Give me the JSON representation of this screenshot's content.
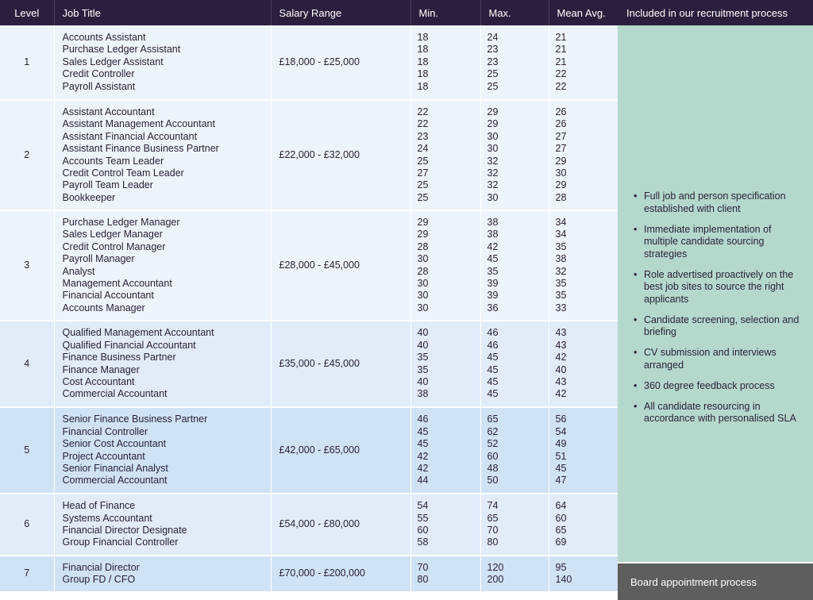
{
  "table": {
    "headers": [
      "Level",
      "Job Title",
      "Salary Range",
      "Min.",
      "Max.",
      "Mean Avg."
    ],
    "rows": [
      {
        "level": "1",
        "range": "£18,000 - £25,000",
        "titles": [
          "Accounts Assistant",
          "Purchase Ledger Assistant",
          "Sales Ledger Assistant",
          "Credit Controller",
          "Payroll Assistant"
        ],
        "min": [
          "18",
          "18",
          "18",
          "18",
          "18"
        ],
        "max": [
          "24",
          "23",
          "23",
          "25",
          "25"
        ],
        "mean": [
          "21",
          "21",
          "21",
          "22",
          "22"
        ]
      },
      {
        "level": "2",
        "range": "£22,000 - £32,000",
        "titles": [
          "Assistant Accountant",
          "Assistant Management Accountant",
          "Assistant Financial Accountant",
          "Assistant Finance Business Partner",
          "Accounts Team Leader",
          "Credit Control Team Leader",
          "Payroll Team Leader",
          "Bookkeeper"
        ],
        "min": [
          "22",
          "22",
          "23",
          "24",
          "25",
          "27",
          "25",
          "25"
        ],
        "max": [
          "29",
          "29",
          "30",
          "30",
          "32",
          "32",
          "32",
          "30"
        ],
        "mean": [
          "26",
          "26",
          "27",
          "27",
          "29",
          "30",
          "29",
          "28"
        ]
      },
      {
        "level": "3",
        "range": "£28,000 - £45,000",
        "titles": [
          "Purchase Ledger Manager",
          "Sales Ledger Manager",
          "Credit Control Manager",
          "Payroll Manager",
          "Analyst",
          "Management Accountant",
          "Financial Accountant",
          "Accounts Manager"
        ],
        "min": [
          "29",
          "29",
          "28",
          "30",
          "28",
          "30",
          "30",
          "30"
        ],
        "max": [
          "38",
          "38",
          "42",
          "45",
          "35",
          "39",
          "39",
          "36"
        ],
        "mean": [
          "34",
          "34",
          "35",
          "38",
          "32",
          "35",
          "35",
          "33"
        ]
      },
      {
        "level": "4",
        "range": "£35,000 - £45,000",
        "titles": [
          "Qualified Management Accountant",
          "Qualified Financial Accountant",
          "Finance Business Partner",
          "Finance Manager",
          "Cost Accountant",
          "Commercial Accountant"
        ],
        "min": [
          "40",
          "40",
          "35",
          "35",
          "40",
          "38"
        ],
        "max": [
          "46",
          "46",
          "45",
          "45",
          "45",
          "45"
        ],
        "mean": [
          "43",
          "43",
          "42",
          "40",
          "43",
          "42"
        ]
      },
      {
        "level": "5",
        "range": "£42,000 - £65,000",
        "titles": [
          "Senior Finance Business Partner",
          "Financial Controller",
          "Senior Cost Accountant",
          "Project Accountant",
          "Senior Financial Analyst",
          "Commercial Accountant"
        ],
        "min": [
          "46",
          "45",
          "45",
          "42",
          "42",
          "44"
        ],
        "max": [
          "65",
          "62",
          "52",
          "60",
          "48",
          "50"
        ],
        "mean": [
          "56",
          "54",
          "49",
          "51",
          "45",
          "47"
        ]
      },
      {
        "level": "6",
        "range": "£54,000 - £80,000",
        "titles": [
          "Head of Finance",
          "Systems Accountant",
          "Financial Director Designate",
          "Group Financial Controller"
        ],
        "min": [
          "54",
          "55",
          "60",
          "58"
        ],
        "max": [
          "74",
          "65",
          "70",
          "80"
        ],
        "mean": [
          "64",
          "60",
          "65",
          "69"
        ]
      },
      {
        "level": "7",
        "range": "£70,000 - £200,000",
        "titles": [
          "Financial Director",
          "Group FD / CFO"
        ],
        "min": [
          "70",
          "80"
        ],
        "max": [
          "120",
          "200"
        ],
        "mean": [
          "95",
          "140"
        ]
      }
    ]
  },
  "side": {
    "header": "Included in our recruitment process",
    "bullet_glyph": "•",
    "points": [
      "Full job and person specification established with client",
      "Immediate implementation of multiple candidate sourcing strategies",
      "Role advertised proactively on the best job sites to source the right applicants",
      "Candidate screening, selection and briefing",
      "CV submission and interviews arranged",
      "360 degree feedback process",
      "All candidate resourcing in accordance with personalised SLA"
    ],
    "footer": "Board appointment process"
  },
  "colors": {
    "header_bg": "#2a1f3d",
    "green_panel": "#b5d8cc",
    "grey_panel": "#5f5e5e",
    "row_light": "#eef4fb",
    "row_mid": "#e1ecf8",
    "row_dark": "#d0e2f6"
  }
}
